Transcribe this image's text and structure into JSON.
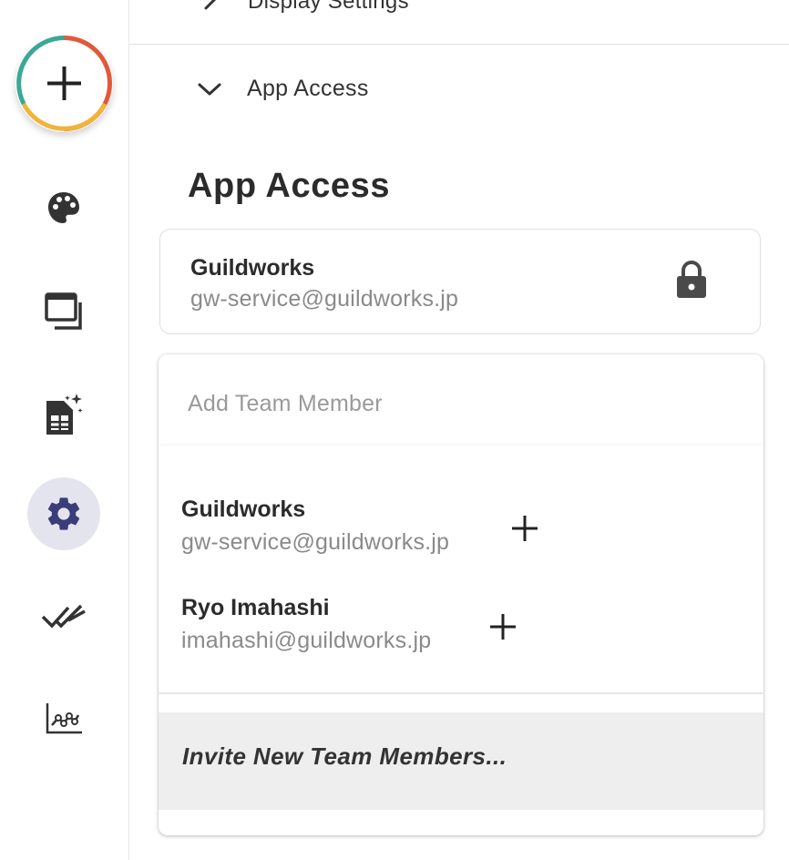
{
  "fab": {
    "icon": "plus-icon",
    "ring_colors": [
      "#e05a3a",
      "#f0b43c",
      "#3aa897"
    ]
  },
  "rail": {
    "items": [
      {
        "icon": "palette-icon",
        "active": false
      },
      {
        "icon": "windows-icon",
        "active": false
      },
      {
        "icon": "sparkle-sheet-icon",
        "active": false
      },
      {
        "icon": "gear-icon",
        "active": true
      },
      {
        "icon": "double-check-icon",
        "active": false
      },
      {
        "icon": "line-chart-icon",
        "active": false
      }
    ],
    "active_bg": "#e4e4ee",
    "active_icon_color": "#3b3d7a"
  },
  "panel": {
    "display_settings_label": "Display Settings",
    "app_access_label": "App Access",
    "heading": "App Access",
    "owner": {
      "name": "Guildworks",
      "email": "gw-service@guildworks.jp",
      "icon": "lock-icon"
    },
    "dropdown": {
      "placeholder": "Add Team Member",
      "members": [
        {
          "name": "Guildworks",
          "email": "gw-service@guildworks.jp"
        },
        {
          "name": "Ryo Imahashi",
          "email": "imahashi@guildworks.jp"
        }
      ],
      "invite_label": "Invite New Team Members..."
    }
  }
}
